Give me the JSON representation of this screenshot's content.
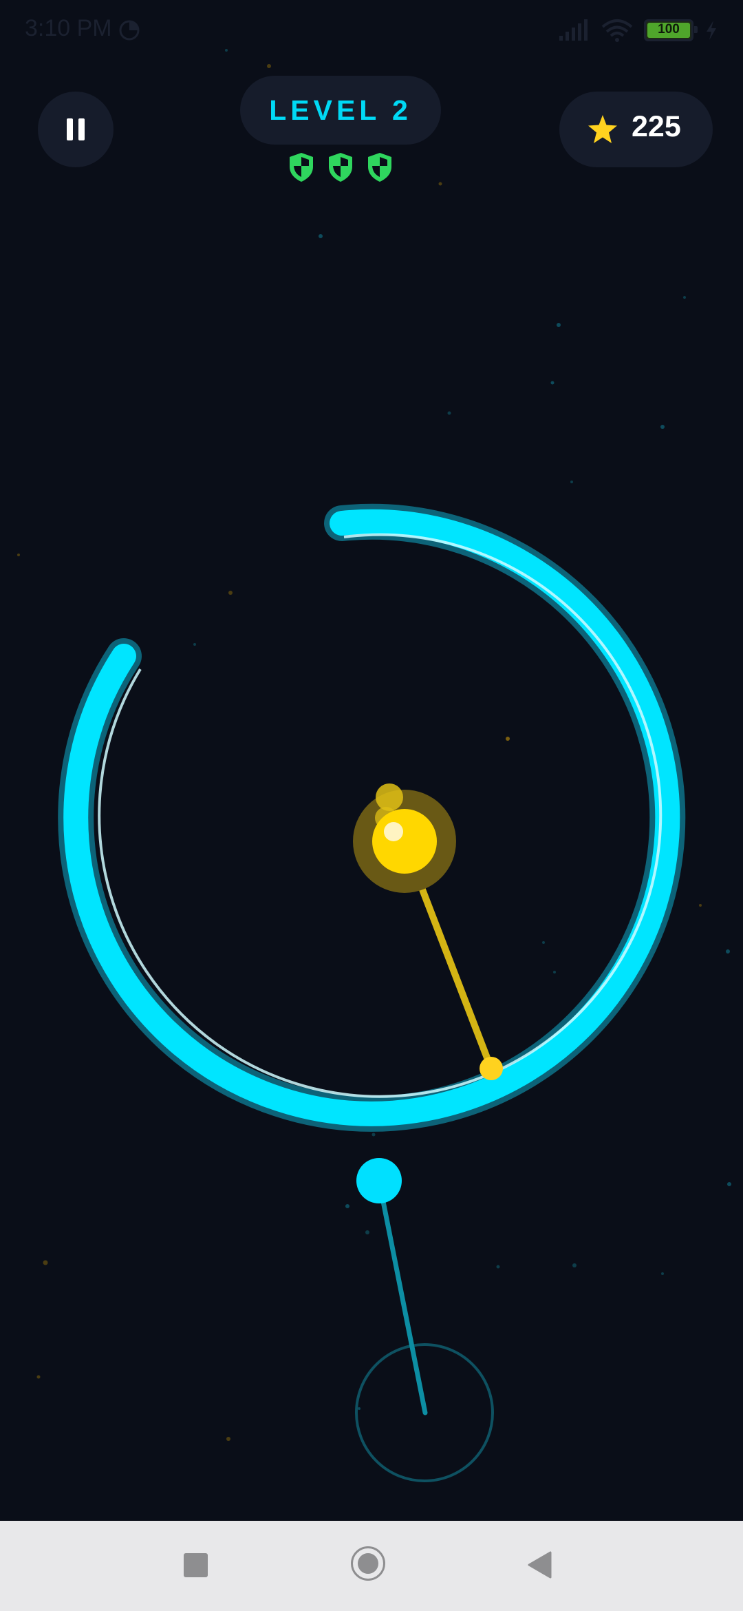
{
  "status_bar": {
    "time": "3:10 PM",
    "battery_level": "100"
  },
  "hud": {
    "level_label": "LEVEL 2",
    "shield_count": 3,
    "score": "225"
  },
  "icons": {
    "pause": "pause-icon",
    "star": "star-icon",
    "shield": "shield-icon",
    "signal": "signal-icon",
    "wifi": "wifi-icon",
    "battery": "battery-icon",
    "charging": "bolt-icon",
    "nav_recents": "square-icon",
    "nav_home": "circle-icon",
    "nav_back": "triangle-back-icon"
  },
  "colors": {
    "background": "#0a0e18",
    "ring": "#00e5ff",
    "ring_glow": "#0d6378",
    "player": "#ffd700",
    "tether": "#d4b414",
    "shield": "#2fd65e",
    "star": "#ffd21f",
    "level_text": "#00d9f5",
    "pill": "#161c2b",
    "nav_bar": "#e8e8ea"
  }
}
